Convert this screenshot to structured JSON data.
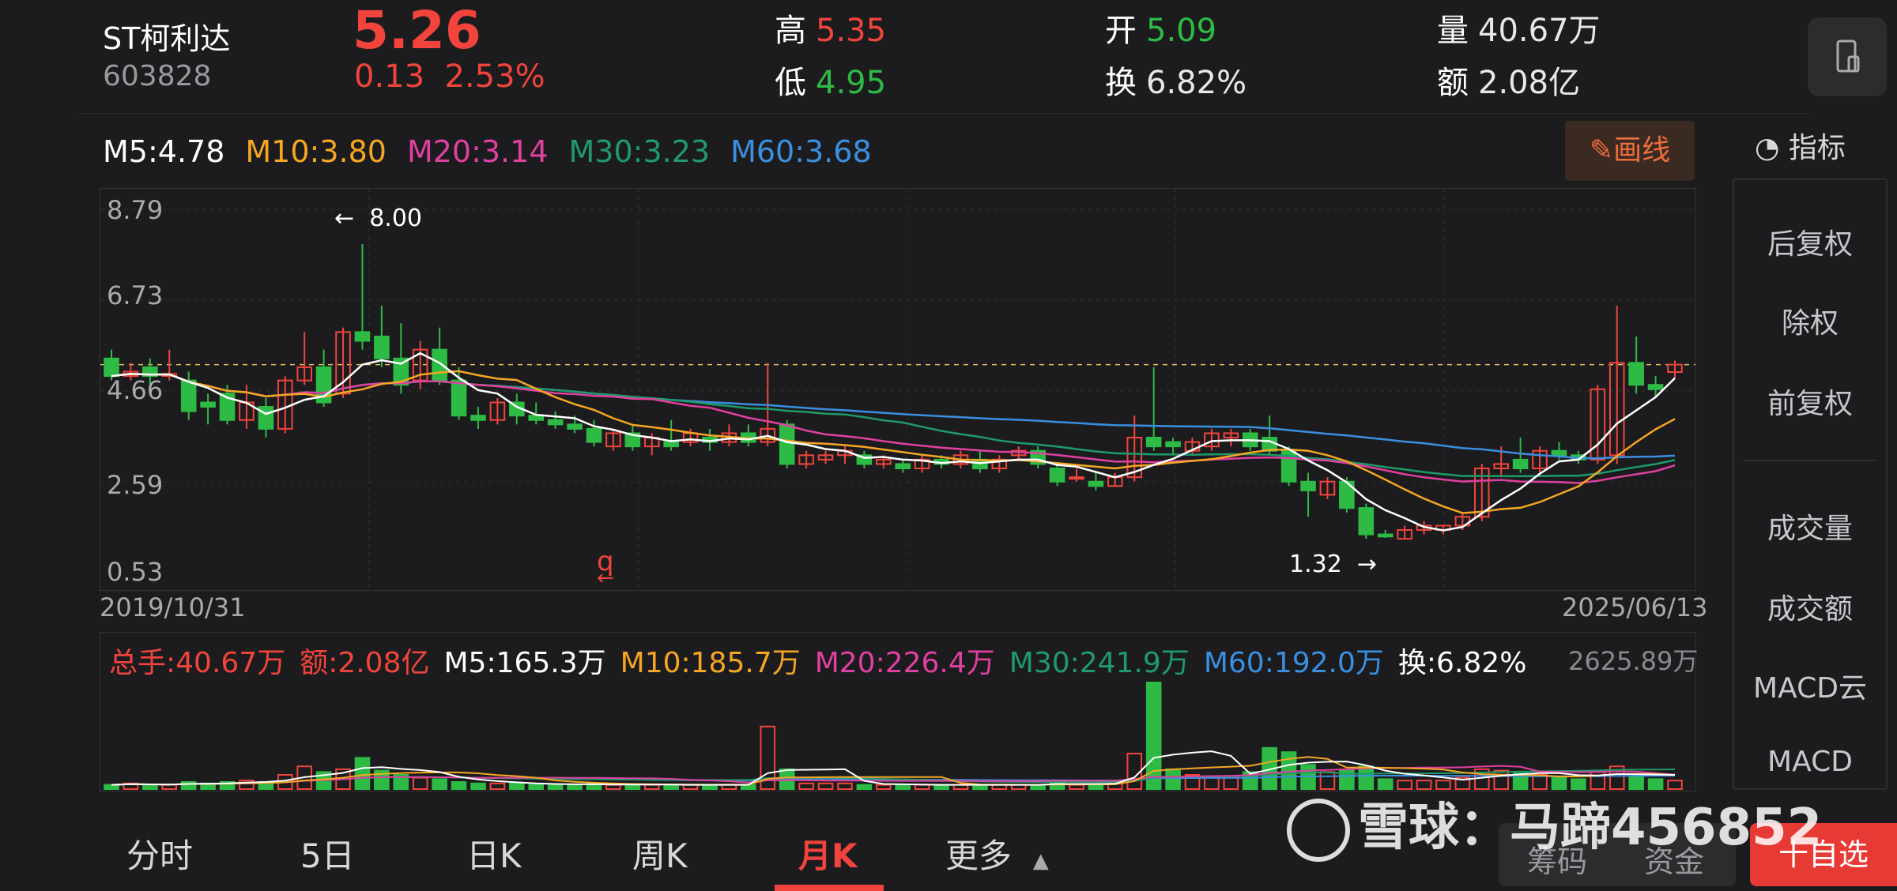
{
  "header": {
    "name": "ST柯利达",
    "code": "603828",
    "price": "5.26",
    "change": "0.13",
    "change_pct": "2.53%",
    "high_label": "高",
    "high": "5.35",
    "low_label": "低",
    "low": "4.95",
    "open_label": "开",
    "open": "5.09",
    "turnover_label": "换",
    "turnover": "6.82%",
    "volume_label": "量",
    "volume": "40.67万",
    "amount_label": "额",
    "amount": "2.08亿"
  },
  "ma": {
    "m5": "M5:4.78",
    "m10": "M10:3.80",
    "m20": "M20:3.14",
    "m30": "M30:3.23",
    "m60": "M60:3.68"
  },
  "toolbar": {
    "draw_label": "画线",
    "indicator_label": "指标"
  },
  "sidebar": {
    "items": [
      "后复权",
      "除权",
      "前复权",
      "成交量",
      "成交额",
      "MACD云",
      "MACD"
    ]
  },
  "chart_data": {
    "type": "candlestick",
    "y_ticks": [
      "8.79",
      "6.73",
      "4.66",
      "2.59",
      "0.53"
    ],
    "start_date": "2019/10/31",
    "end_date": "2025/06/13",
    "annotations": {
      "high": "8.00",
      "low": "1.32",
      "q_marker": "q"
    },
    "reference_price": 5.26,
    "colors": {
      "up": "#f0443c",
      "down": "#2dbb45",
      "m5": "#ffffff",
      "m10": "#f5a623",
      "m20": "#e040a0",
      "m30": "#1f9a6a",
      "m60": "#3a8fe0"
    }
  },
  "volume": {
    "total": "总手:40.67万",
    "amount": "额:2.08亿",
    "m5": "M5:165.3万",
    "m10": "M10:185.7万",
    "m20": "M20:226.4万",
    "m30": "M30:241.9万",
    "m60": "M60:192.0万",
    "turnover": "换:6.82%",
    "max": "2625.89万"
  },
  "tabs": [
    "分时",
    "5日",
    "日K",
    "周K",
    "月K",
    "更多"
  ],
  "bottom_buttons": {
    "chips": "筹码",
    "funds": "资金",
    "add": "十自选"
  },
  "watermark": "雪球：马蹄456852"
}
